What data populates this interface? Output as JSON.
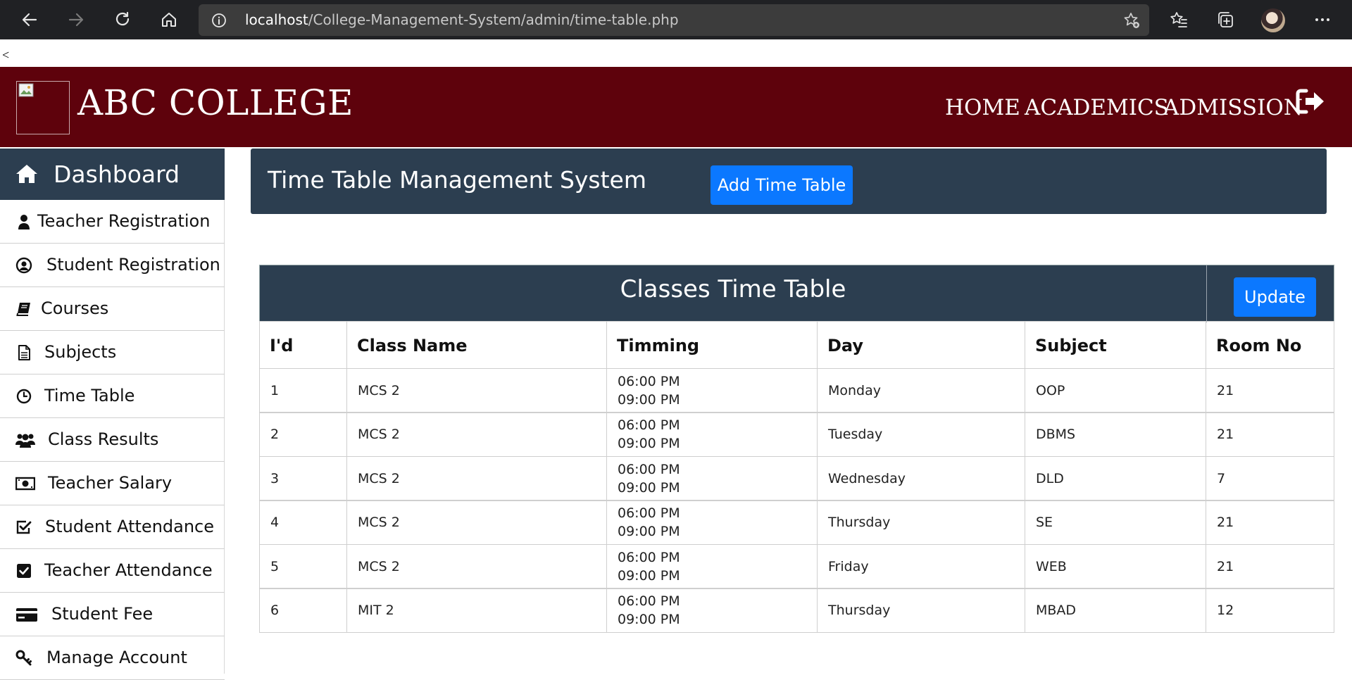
{
  "browser": {
    "url_host": "localhost",
    "url_path": "/College-Management-System/admin/time-table.php"
  },
  "stray_text": "<",
  "header": {
    "brand": "ABC COLLEGE",
    "nav": [
      "HOME",
      "ACADEMICS",
      "ADMISSION"
    ],
    "bg_color": "#5e020c"
  },
  "sidebar": {
    "dashboard_label": "Dashboard",
    "items": [
      {
        "label": "Teacher Registration",
        "icon": "user-icon"
      },
      {
        "label": "Student Registration",
        "icon": "user-circle-icon"
      },
      {
        "label": "Courses",
        "icon": "book-icon"
      },
      {
        "label": "Subjects",
        "icon": "file-text-icon"
      },
      {
        "label": "Time Table",
        "icon": "clock-icon"
      },
      {
        "label": "Class Results",
        "icon": "users-icon"
      },
      {
        "label": "Teacher Salary",
        "icon": "money-icon"
      },
      {
        "label": "Student Attendance",
        "icon": "check-square-icon"
      },
      {
        "label": "Teacher Attendance",
        "icon": "check-square-filled-icon"
      },
      {
        "label": "Student Fee",
        "icon": "credit-card-icon"
      },
      {
        "label": "Manage Account",
        "icon": "key-icon"
      }
    ]
  },
  "banner": {
    "title": "Time Table Management System",
    "add_button": "Add Time Table"
  },
  "timetable": {
    "title": "Classes Time Table",
    "update_button": "Update",
    "columns": [
      "I'd",
      "Class Name",
      "Timming",
      "Day",
      "Subject",
      "Room No"
    ],
    "rows": [
      {
        "id": "1",
        "class": "MCS 2",
        "start": "06:00 PM",
        "end": "09:00 PM",
        "day": "Monday",
        "subject": "OOP",
        "room": "21"
      },
      {
        "id": "2",
        "class": "MCS 2",
        "start": "06:00 PM",
        "end": "09:00 PM",
        "day": "Tuesday",
        "subject": "DBMS",
        "room": "21"
      },
      {
        "id": "3",
        "class": "MCS 2",
        "start": "06:00 PM",
        "end": "09:00 PM",
        "day": "Wednesday",
        "subject": "DLD",
        "room": "7"
      },
      {
        "id": "4",
        "class": "MCS 2",
        "start": "06:00 PM",
        "end": "09:00 PM",
        "day": "Thursday",
        "subject": "SE",
        "room": "21"
      },
      {
        "id": "5",
        "class": "MCS 2",
        "start": "06:00 PM",
        "end": "09:00 PM",
        "day": "Friday",
        "subject": "WEB",
        "room": "21"
      },
      {
        "id": "6",
        "class": "MIT 2",
        "start": "06:00 PM",
        "end": "09:00 PM",
        "day": "Thursday",
        "subject": "MBAD",
        "room": "12"
      }
    ]
  },
  "colors": {
    "panel": "#2c3e50",
    "primary_button": "#0b78ff"
  }
}
